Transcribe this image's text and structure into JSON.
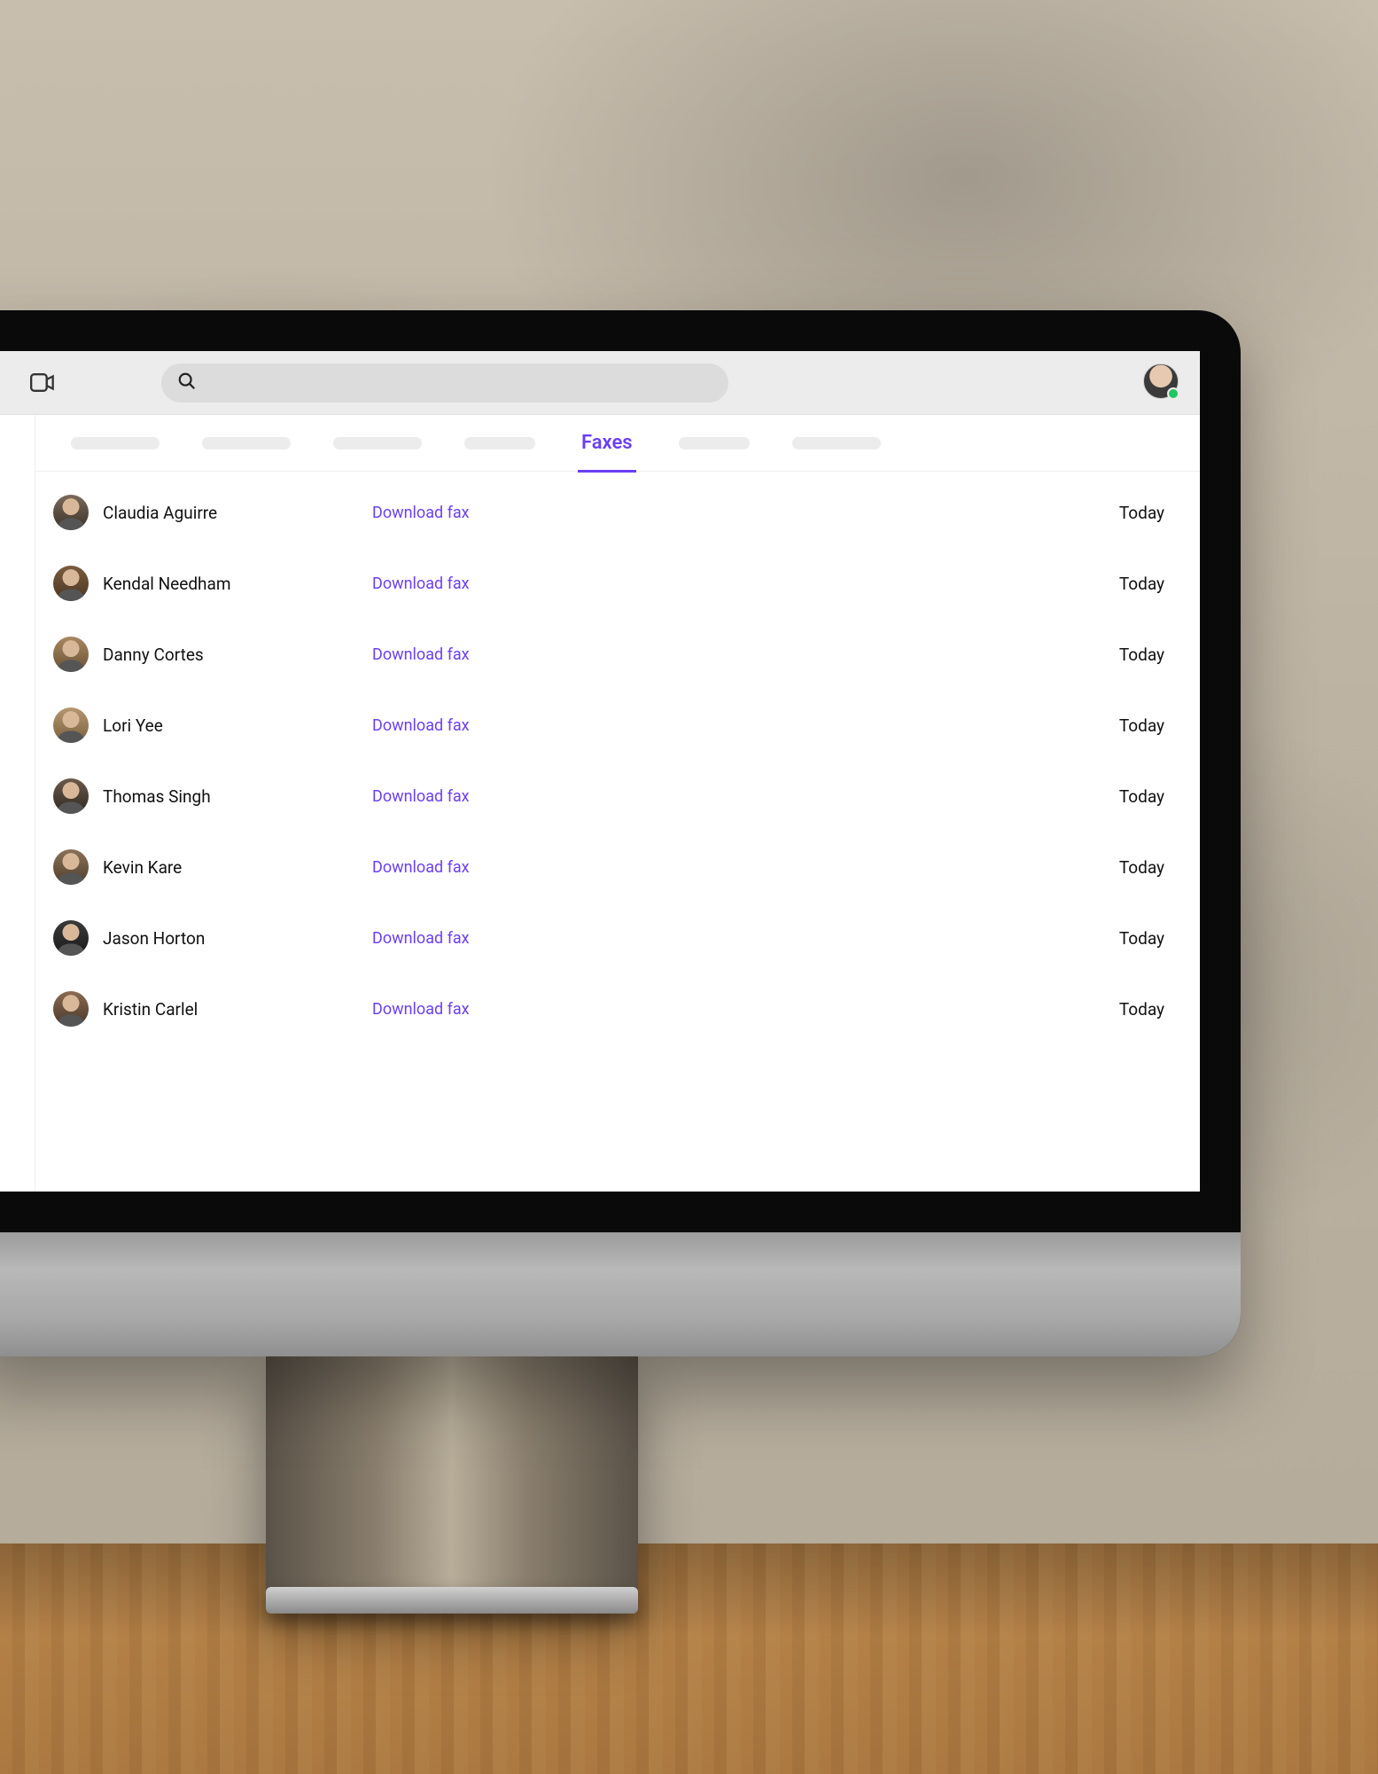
{
  "colors": {
    "accent": "#6b3ff5",
    "presence_online": "#22c55e"
  },
  "header": {
    "video_icon": "video-icon",
    "search_placeholder": "",
    "avatar_icon": "user-avatar",
    "presence": "online"
  },
  "tabs": {
    "active_label": "Faxes",
    "placeholders_before": 4,
    "placeholders_after": 2
  },
  "faxes": [
    {
      "name": "Claudia Aguirre",
      "action": "Download fax",
      "time": "Today"
    },
    {
      "name": "Kendal Needham",
      "action": "Download fax",
      "time": "Today"
    },
    {
      "name": "Danny Cortes",
      "action": "Download fax",
      "time": "Today"
    },
    {
      "name": "Lori Yee",
      "action": "Download fax",
      "time": "Today"
    },
    {
      "name": "Thomas Singh",
      "action": "Download fax",
      "time": "Today"
    },
    {
      "name": "Kevin Kare",
      "action": "Download fax",
      "time": "Today"
    },
    {
      "name": "Jason Horton",
      "action": "Download fax",
      "time": "Today"
    },
    {
      "name": "Kristin Carlel",
      "action": "Download fax",
      "time": "Today"
    }
  ]
}
